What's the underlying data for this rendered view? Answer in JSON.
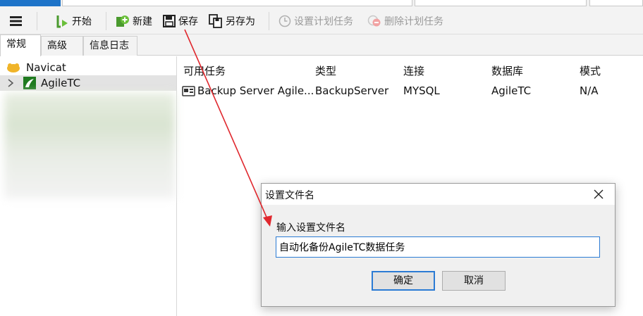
{
  "toolbar": {
    "start": "开始",
    "new": "新建",
    "save": "保存",
    "save_as": "另存为",
    "set_schedule": "设置计划任务",
    "delete_schedule": "删除计划任务"
  },
  "tabs": [
    "常规",
    "高级",
    "信息日志"
  ],
  "tree": {
    "root": "Navicat",
    "child": "AgileTC"
  },
  "table": {
    "columns": [
      "可用任务",
      "类型",
      "连接",
      "数据库",
      "模式"
    ],
    "rows": [
      [
        "Backup Server Agile...",
        "BackupServer",
        "MYSQL",
        "AgileTC",
        "N/A"
      ]
    ]
  },
  "dialog": {
    "title": "设置文件名",
    "label": "输入设置文件名",
    "input_value": "自动化备份AgileTC数据任务",
    "ok": "确定",
    "cancel": "取消"
  },
  "colors": {
    "accent": "#2b7bd4",
    "annotation_arrow": "#e0282e"
  },
  "icons": [
    "menu-icon",
    "start-icon",
    "new-icon",
    "save-icon",
    "save-as-icon",
    "clock-icon",
    "delete-schedule-icon",
    "navicat-icon",
    "connection-icon",
    "task-icon",
    "close-icon",
    "expand-chevron-icon"
  ]
}
